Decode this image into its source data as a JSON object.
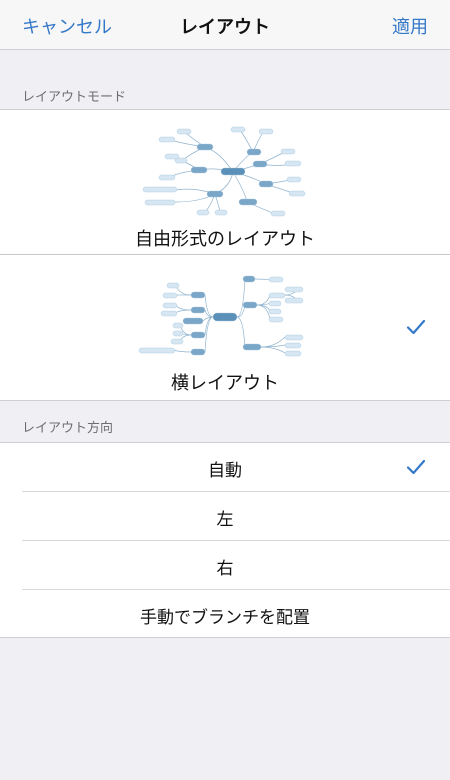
{
  "navbar": {
    "cancel_label": "キャンセル",
    "title": "レイアウト",
    "apply_label": "適用"
  },
  "layout_mode": {
    "header": "レイアウトモード",
    "options": [
      {
        "label": "自由形式のレイアウト",
        "selected": false,
        "preview": "freeform-mindmap-thumbnail"
      },
      {
        "label": "横レイアウト",
        "selected": true,
        "preview": "horizontal-mindmap-thumbnail"
      }
    ]
  },
  "layout_direction": {
    "header": "レイアウト方向",
    "options": [
      {
        "label": "自動",
        "selected": true
      },
      {
        "label": "左",
        "selected": false
      },
      {
        "label": "右",
        "selected": false
      },
      {
        "label": "手動でブランチを配置",
        "selected": false
      }
    ]
  },
  "colors": {
    "accent": "#3478c8",
    "background": "#efeff4",
    "node_fill": "#d6e6f2",
    "node_main": "#5b90b8"
  },
  "icons": {
    "check": "checkmark-icon"
  }
}
